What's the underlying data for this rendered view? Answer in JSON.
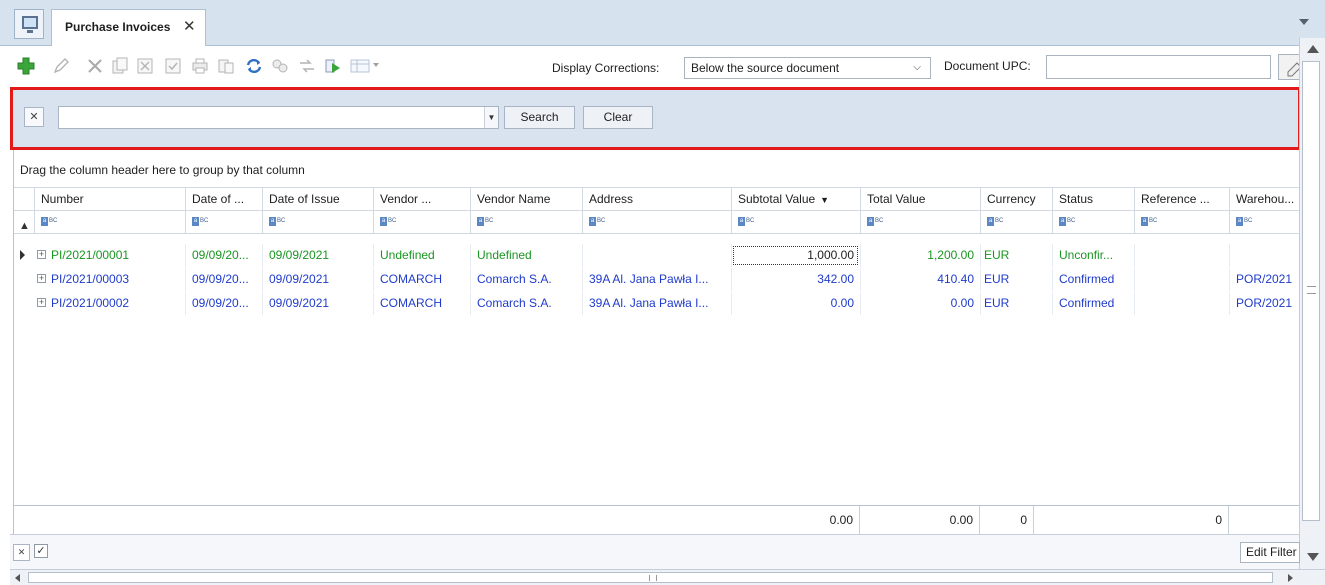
{
  "window": {
    "tab_title": "Purchase Invoices",
    "tab_close": "✕"
  },
  "toolbar": {
    "buttons": [
      {
        "name": "add-icon"
      },
      {
        "name": "edit-icon"
      },
      {
        "name": "delete-icon"
      },
      {
        "name": "copy-icon"
      },
      {
        "name": "cancel-document-icon"
      },
      {
        "name": "approve-icon"
      },
      {
        "name": "print-icon"
      },
      {
        "name": "generate-document-icon"
      },
      {
        "name": "refresh-icon"
      },
      {
        "name": "related-documents-icon"
      },
      {
        "name": "transfer-icon"
      },
      {
        "name": "run-icon"
      },
      {
        "name": "views-icon"
      }
    ],
    "display_corrections_label": "Display Corrections:",
    "display_corrections_value": "Below the source document",
    "document_upc_label": "Document UPC:",
    "document_upc_value": ""
  },
  "filter": {
    "value": "",
    "search_label": "Search",
    "clear_label": "Clear"
  },
  "grid": {
    "group_hint": "Drag the column header here to group by that column",
    "columns": [
      "Number",
      "Date of ...",
      "Date of Issue",
      "Vendor ...",
      "Vendor Name",
      "Address",
      "Subtotal Value",
      "Total Value",
      "Currency",
      "Status",
      "Reference ...",
      "Warehou..."
    ],
    "sorted_column": "Subtotal Value",
    "filter_cell_icon": "text-filter-icon",
    "rows": [
      {
        "number": "PI/2021/00001",
        "date_of": "09/09/20...",
        "date_issue": "09/09/2021",
        "vendor_code": "Undefined",
        "vendor_name": "Undefined",
        "address": "",
        "subtotal": "1,000.00",
        "total": "1,200.00",
        "currency": "EUR",
        "status": "Unconfir...",
        "reference": "",
        "warehouse": "",
        "color": "#1a9622"
      },
      {
        "number": "PI/2021/00003",
        "date_of": "09/09/20...",
        "date_issue": "09/09/2021",
        "vendor_code": "COMARCH",
        "vendor_name": "Comarch S.A.",
        "address": "39A Al. Jana Pawła I...",
        "subtotal": "342.00",
        "total": "410.40",
        "currency": "EUR",
        "status": "Confirmed",
        "reference": "",
        "warehouse": "POR/2021",
        "color": "#1f3bcb"
      },
      {
        "number": "PI/2021/00002",
        "date_of": "09/09/20...",
        "date_issue": "09/09/2021",
        "vendor_code": "COMARCH",
        "vendor_name": "Comarch S.A.",
        "address": "39A Al. Jana Pawła I...",
        "subtotal": "0.00",
        "total": "0.00",
        "currency": "EUR",
        "status": "Confirmed",
        "reference": "",
        "warehouse": "POR/2021",
        "color": "#1f3bcb"
      }
    ],
    "footer": {
      "subtotal_sum": "0.00",
      "total_sum": "0.00",
      "currency_count": "0",
      "reference_count": "0"
    }
  },
  "statusbar": {
    "edit_filter_label": "Edit Filter"
  }
}
